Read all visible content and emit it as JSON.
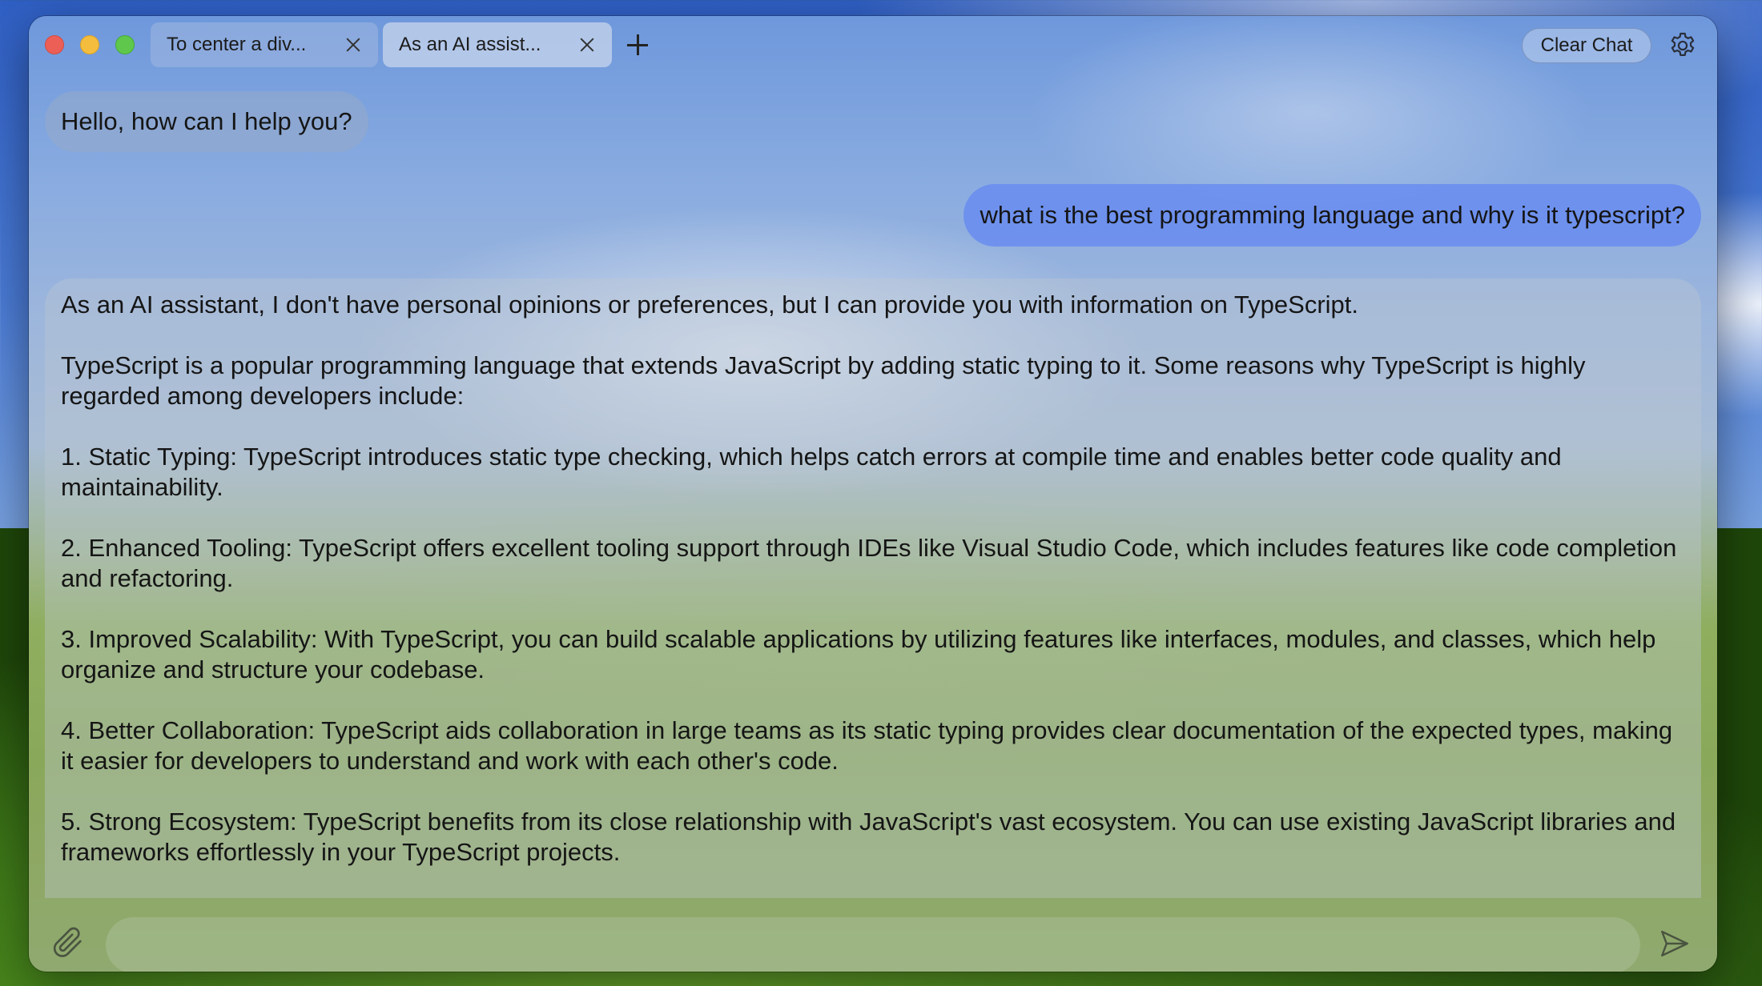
{
  "window": {
    "tabs": [
      {
        "label": "To center a div..."
      },
      {
        "label": "As an AI assist..."
      }
    ],
    "toolbar": {
      "clear_chat_label": "Clear Chat"
    }
  },
  "chat": {
    "greeting": "Hello, how can I help you?",
    "user_message": "what is the best programming language and why is it typescript?",
    "ai_response": {
      "paragraphs": [
        "As an AI assistant, I don't have personal opinions or preferences, but I can provide you with information on TypeScript.",
        "TypeScript is a popular programming language that extends JavaScript by adding static typing to it. Some reasons why TypeScript is highly regarded among developers include:",
        "1. Static Typing: TypeScript introduces static type checking, which helps catch errors at compile time and enables better code quality and maintainability.",
        "2. Enhanced Tooling: TypeScript offers excellent tooling support through IDEs like Visual Studio Code, which includes features like code completion and refactoring.",
        "3. Improved Scalability: With TypeScript, you can build scalable applications by utilizing features like interfaces, modules, and classes, which help organize and structure your codebase.",
        "4. Better Collaboration: TypeScript aids collaboration in large teams as its static typing provides clear documentation of the expected types, making it easier for developers to understand and work with each other's code.",
        "5. Strong Ecosystem: TypeScript benefits from its close relationship with JavaScript's vast ecosystem. You can use existing JavaScript libraries and frameworks effortlessly in your TypeScript projects."
      ]
    }
  },
  "composer": {
    "value": "",
    "placeholder": ""
  },
  "icons": {
    "settings": "gear-icon",
    "attach": "paperclip-icon",
    "send": "send-icon",
    "new_tab": "plus-icon",
    "tab_close": "close-icon"
  },
  "colors": {
    "traffic_red": "#ec5f57",
    "traffic_yellow": "#f4bd3e",
    "traffic_green": "#5fc84c",
    "user_bubble": "#688cf0"
  }
}
